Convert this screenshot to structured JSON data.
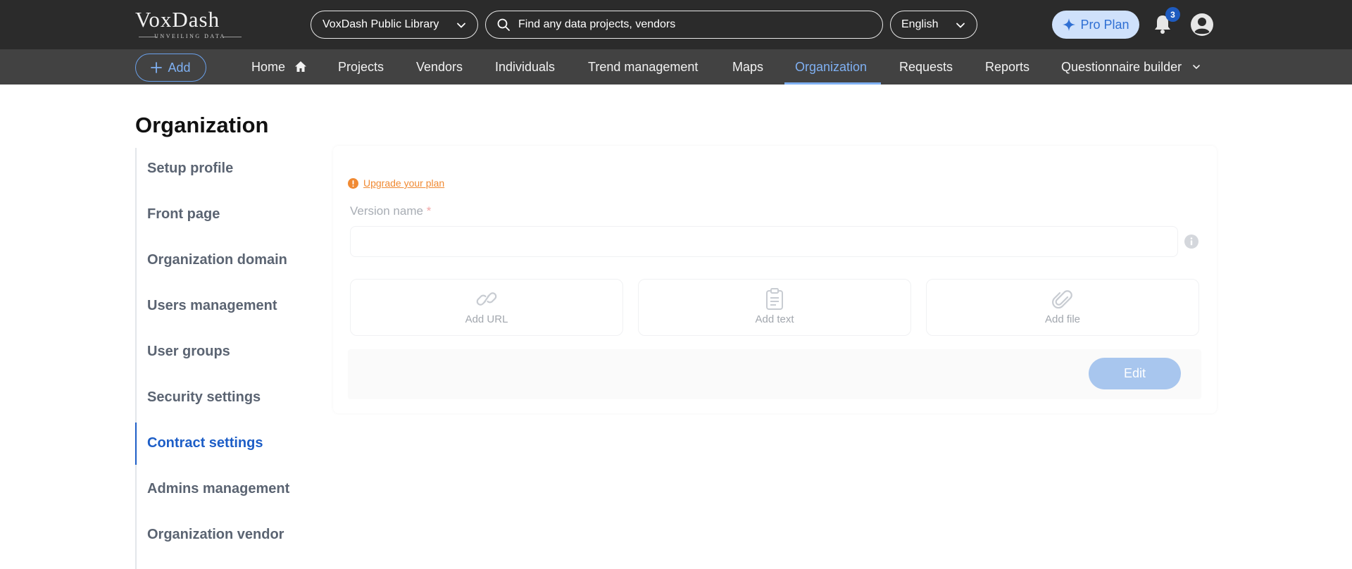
{
  "header": {
    "logo_text": "VoxDash",
    "logo_tagline": "UNVEILING DATA",
    "library_select": "VoxDash Public Library",
    "search_placeholder": "Find any data projects, vendors",
    "language": "English",
    "pro_plan_label": "Pro Plan",
    "notification_count": "3"
  },
  "navbar": {
    "add_label": "Add",
    "items": [
      {
        "label": "Home",
        "icon": "home-icon"
      },
      {
        "label": "Projects"
      },
      {
        "label": "Vendors"
      },
      {
        "label": "Individuals"
      },
      {
        "label": "Trend management"
      },
      {
        "label": "Maps"
      },
      {
        "label": "Organization",
        "active": true
      },
      {
        "label": "Requests"
      },
      {
        "label": "Reports"
      },
      {
        "label": "Questionnaire builder",
        "icon": "chevron-down-icon"
      }
    ]
  },
  "page": {
    "title": "Organization"
  },
  "sidebar": {
    "items": [
      {
        "label": "Setup profile"
      },
      {
        "label": "Front page"
      },
      {
        "label": "Organization domain"
      },
      {
        "label": "Users management"
      },
      {
        "label": "User groups"
      },
      {
        "label": "Security settings"
      },
      {
        "label": "Contract settings",
        "active": true
      },
      {
        "label": "Admins management"
      },
      {
        "label": "Organization vendor"
      }
    ]
  },
  "form": {
    "upgrade_link": "Upgrade your plan",
    "version_label": "Version name",
    "required_mark": "*",
    "version_value": "",
    "attachments": [
      {
        "label": "Add URL",
        "icon": "link-icon"
      },
      {
        "label": "Add text",
        "icon": "clipboard-icon"
      },
      {
        "label": "Add file",
        "icon": "paperclip-icon"
      }
    ],
    "edit_label": "Edit"
  },
  "colors": {
    "topbar": "#2b2b2b",
    "navbar": "#424242",
    "accent": "#1d5ec7",
    "nav_active": "#7fb0f2",
    "warning": "#f08a33"
  }
}
